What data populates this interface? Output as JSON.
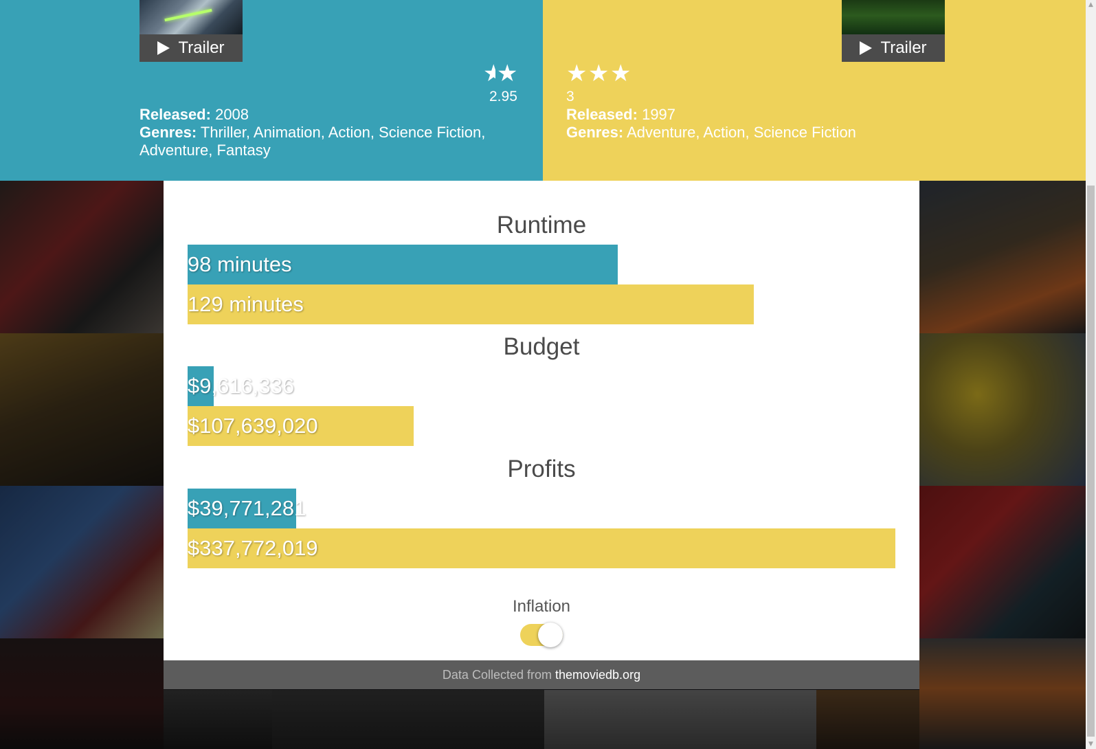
{
  "movie_left": {
    "trailer_label": "Trailer",
    "rating_value": 2.95,
    "rating_text": "2.95",
    "released_label": "Released:",
    "released": "2008",
    "genres_label": "Genres:",
    "genres": "Thriller, Animation, Action, Science Fiction, Adventure, Fantasy"
  },
  "movie_right": {
    "trailer_label": "Trailer",
    "rating_value": 3,
    "rating_text": "3",
    "released_label": "Released:",
    "released": "1997",
    "genres_label": "Genres:",
    "genres": "Adventure, Action, Science Fiction"
  },
  "comparison": {
    "runtime": {
      "title": "Runtime",
      "left_label": "98 minutes",
      "right_label": "129 minutes",
      "left_fraction": 0.608,
      "right_fraction": 0.8
    },
    "budget": {
      "title": "Budget",
      "left_label": "$9,616,336",
      "right_label": "$107,639,020",
      "left_fraction": 0.037,
      "right_fraction": 0.319
    },
    "profits": {
      "title": "Profits",
      "left_label": "$39,771,281",
      "right_label": "$337,772,019",
      "left_fraction": 0.153,
      "right_fraction": 1.0
    }
  },
  "inflation": {
    "label": "Inflation",
    "enabled": true
  },
  "footer": {
    "prefix": "Data Collected from ",
    "link": "themoviedb.org"
  },
  "colors": {
    "left_accent": "#38a1b6",
    "right_accent": "#eed25a"
  }
}
